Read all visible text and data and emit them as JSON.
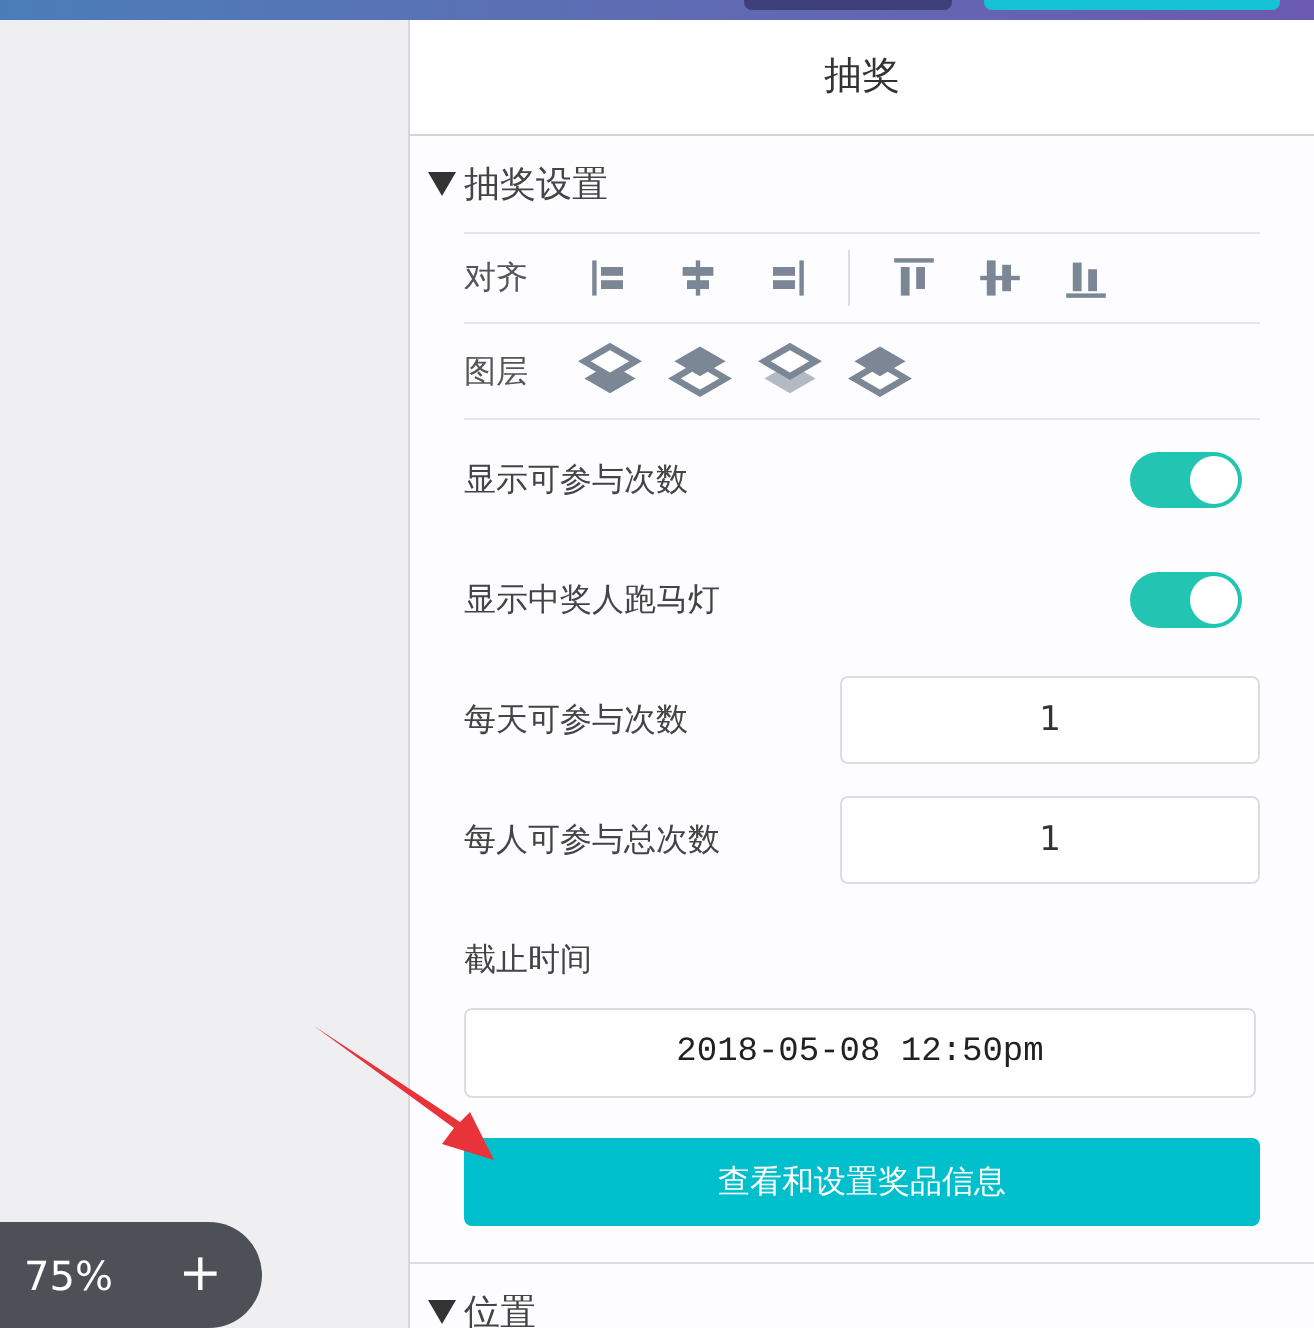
{
  "zoom": {
    "value": "75%",
    "zoom_in": "+"
  },
  "panel": {
    "title": "抽奖"
  },
  "sections": [
    {
      "title": "抽奖设置",
      "expanded": true
    },
    {
      "title": "位置",
      "expanded": true
    }
  ],
  "align": {
    "label": "对齐"
  },
  "layers": {
    "label": "图层"
  },
  "toggles": [
    {
      "label": "显示可参与次数",
      "on": true
    },
    {
      "label": "显示中奖人跑马灯",
      "on": true
    }
  ],
  "counts": [
    {
      "label": "每天可参与次数",
      "value": "1"
    },
    {
      "label": "每人可参与总次数",
      "value": "1"
    }
  ],
  "deadline": {
    "label": "截止时间",
    "value": "2018-05-08 12:50pm"
  },
  "prize_button": "查看和设置奖品信息"
}
